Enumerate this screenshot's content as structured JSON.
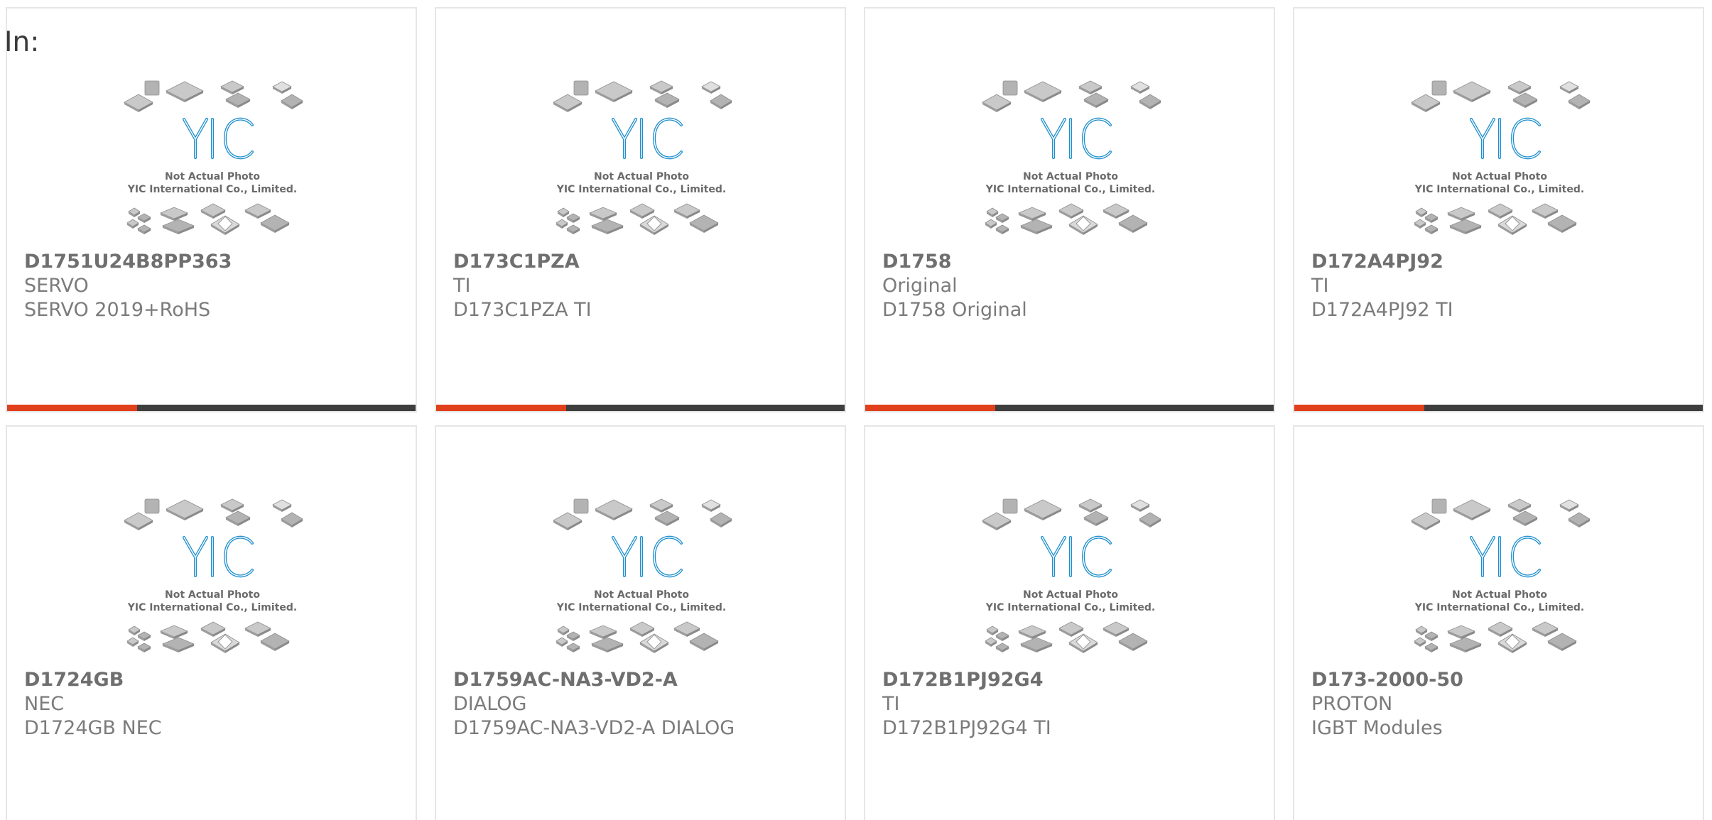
{
  "label_in": "In:",
  "photo": {
    "logo_text": "YIC",
    "line1": "Not Actual Photo",
    "line2": "YIC International Co., Limited."
  },
  "colors": {
    "accent": "#e0401c",
    "bar_dark": "#3e3e3e",
    "logo_blue": "#1f8fce",
    "text": "#7b7b7b"
  },
  "products": [
    {
      "part": "D1751U24B8PP363",
      "brand": "SERVO",
      "desc": "SERVO 2019+RoHS",
      "active": true
    },
    {
      "part": "D173C1PZA",
      "brand": "TI",
      "desc": "D173C1PZA TI",
      "active": true
    },
    {
      "part": "D1758",
      "brand": "Original",
      "desc": "D1758 Original",
      "active": true
    },
    {
      "part": "D172A4PJ92",
      "brand": "TI",
      "desc": "D172A4PJ92 TI",
      "active": true
    },
    {
      "part": "D1724GB",
      "brand": "NEC",
      "desc": "D1724GB NEC",
      "active": false
    },
    {
      "part": "D1759AC-NA3-VD2-A",
      "brand": "DIALOG",
      "desc": "D1759AC-NA3-VD2-A DIALOG",
      "active": false
    },
    {
      "part": "D172B1PJ92G4",
      "brand": "TI",
      "desc": "D172B1PJ92G4 TI",
      "active": false
    },
    {
      "part": "D173-2000-50",
      "brand": "PROTON",
      "desc": "IGBT Modules",
      "active": false
    }
  ]
}
